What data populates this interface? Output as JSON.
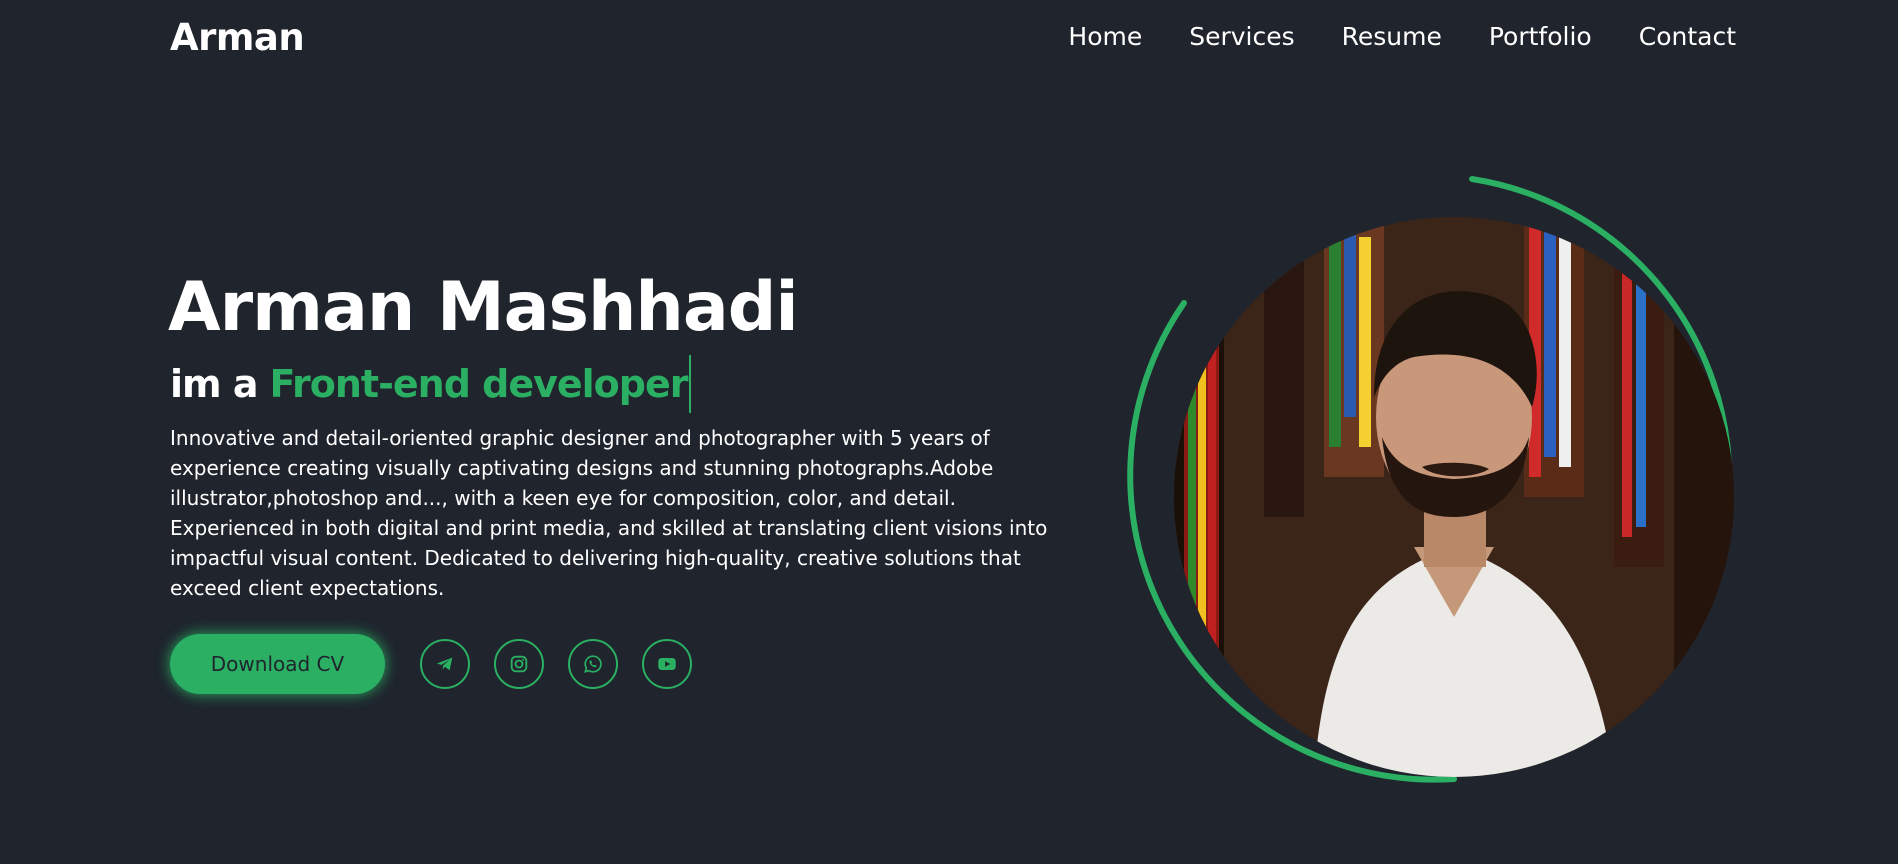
{
  "header": {
    "logo": "Arman",
    "nav": [
      "Home",
      "Services",
      "Resume",
      "Portfolio",
      "Contact"
    ]
  },
  "hero": {
    "name": "Arman Mashhadi",
    "role_prefix": "im a",
    "role_highlight": "Front-end developer",
    "description": "Innovative and detail-oriented graphic designer and photographer with 5 years of experience creating visually captivating designs and stunning photographs.Adobe illustrator,photoshop and..., with a keen eye for composition, color, and detail. Experienced in both digital and print media, and skilled at translating client visions into impactful visual content. Dedicated to delivering high-quality, creative solutions that exceed client expectations.",
    "download_label": "Download CV",
    "socials": [
      "telegram-icon",
      "instagram-icon",
      "whatsapp-icon",
      "youtube-icon"
    ]
  },
  "colors": {
    "background": "#1f242d",
    "accent": "#2aaf63",
    "text": "#ffffff"
  }
}
